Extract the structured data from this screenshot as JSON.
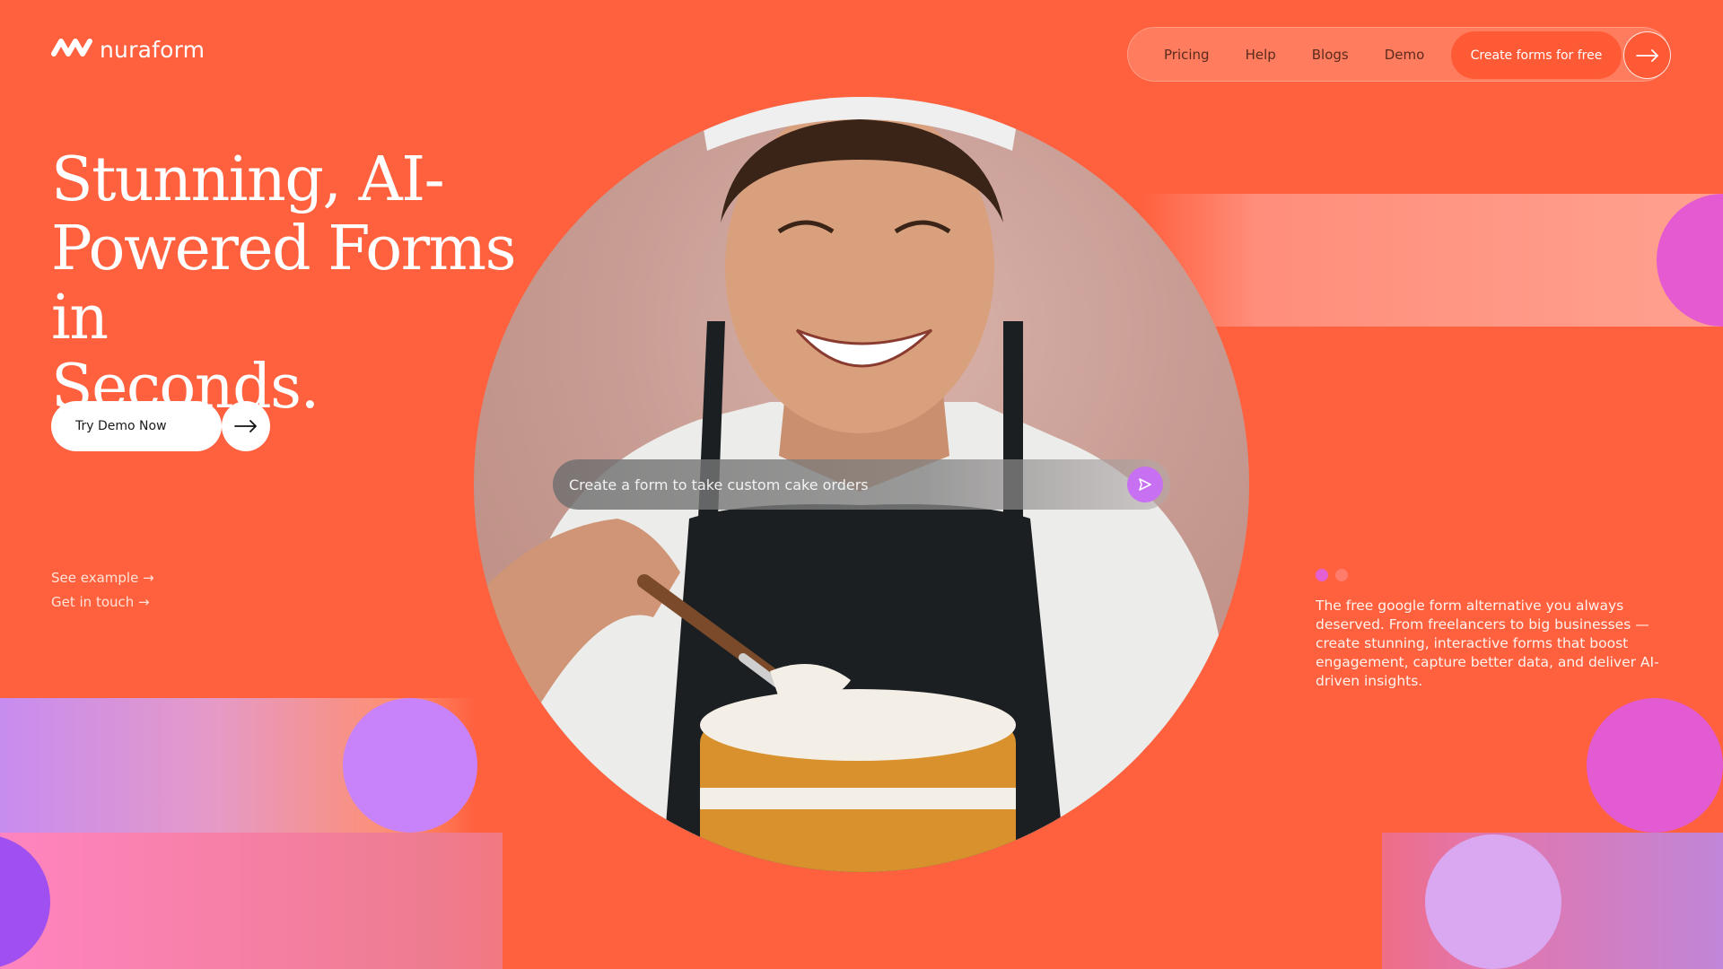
{
  "brand": {
    "name": "nuraform"
  },
  "nav": {
    "links": [
      "Pricing",
      "Help",
      "Blogs",
      "Demo"
    ],
    "cta_label": "Create forms for free"
  },
  "hero": {
    "title_lines": [
      "Stunning, AI-",
      "Powered Forms in",
      "Seconds."
    ],
    "demo_button": "Try Demo Now",
    "links": [
      "See example →",
      "Get in touch →"
    ]
  },
  "prompt": {
    "text": "Create a form to take custom cake orders"
  },
  "tagline": "The free google form alternative you always deserved. From freelancers to big businesses — create stunning, interactive forms that boost engagement, capture better data, and deliver AI-driven insights.",
  "carousel": {
    "active_index": 0,
    "count": 2
  },
  "colors": {
    "background": "#FF603E",
    "accent_purple": "#C883FB",
    "accent_magenta": "#E55AD0",
    "send_button": "#C770F2"
  },
  "icons": [
    "logo-icon",
    "arrow-right-icon",
    "send-icon"
  ]
}
